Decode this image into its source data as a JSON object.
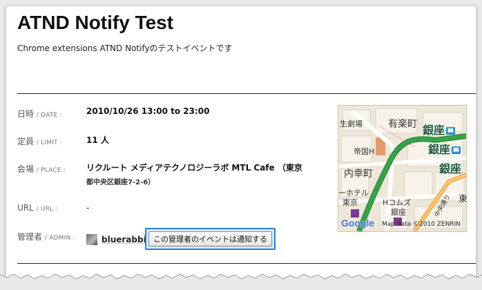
{
  "event": {
    "title": "ATND Notify Test",
    "subtitle": "Chrome extensions ATND Notifyのテストイベントです"
  },
  "rows": {
    "date": {
      "label_ja": "日時",
      "label_en": "DATE",
      "value": "2010/10/26 13:00 to 23:00"
    },
    "limit": {
      "label_ja": "定員",
      "label_en": "LIMIT",
      "value": "11 人"
    },
    "place": {
      "label_ja": "会場",
      "label_en": "PLACE",
      "value": "リクルート メディアテクノロジーラボ MTL Cafe （東京",
      "address": "都中央区銀座7-2-6）"
    },
    "url": {
      "label_ja": "URL",
      "label_en": "URL",
      "value": "-"
    },
    "admin": {
      "label_ja": "管理者",
      "label_en": "ADMIN",
      "name": "bluerabbi"
    }
  },
  "notify_button": {
    "label": "この管理者のイベントは通知する"
  },
  "map": {
    "labels": {
      "theater": "生劇場",
      "yurakucho": "有楽町",
      "ginza1": "銀座",
      "ginza2": "銀座",
      "ginza3": "銀座",
      "teikoku": "帝国H",
      "uchisaiwai": "内幸町",
      "hotel": "ーホテル",
      "tokyo": "東京",
      "hcomuz": "Hコムズ",
      "ginza_small": "銀座",
      "chuo": "中央通り",
      "higashi": "東"
    },
    "google": "Google",
    "credit": "Map data ©2010 ZENRIN",
    "colors": {
      "road_green": "#3aa24a",
      "road_orange": "#f0a640",
      "block": "#f7f3ea",
      "building": "#e29b6b"
    }
  }
}
